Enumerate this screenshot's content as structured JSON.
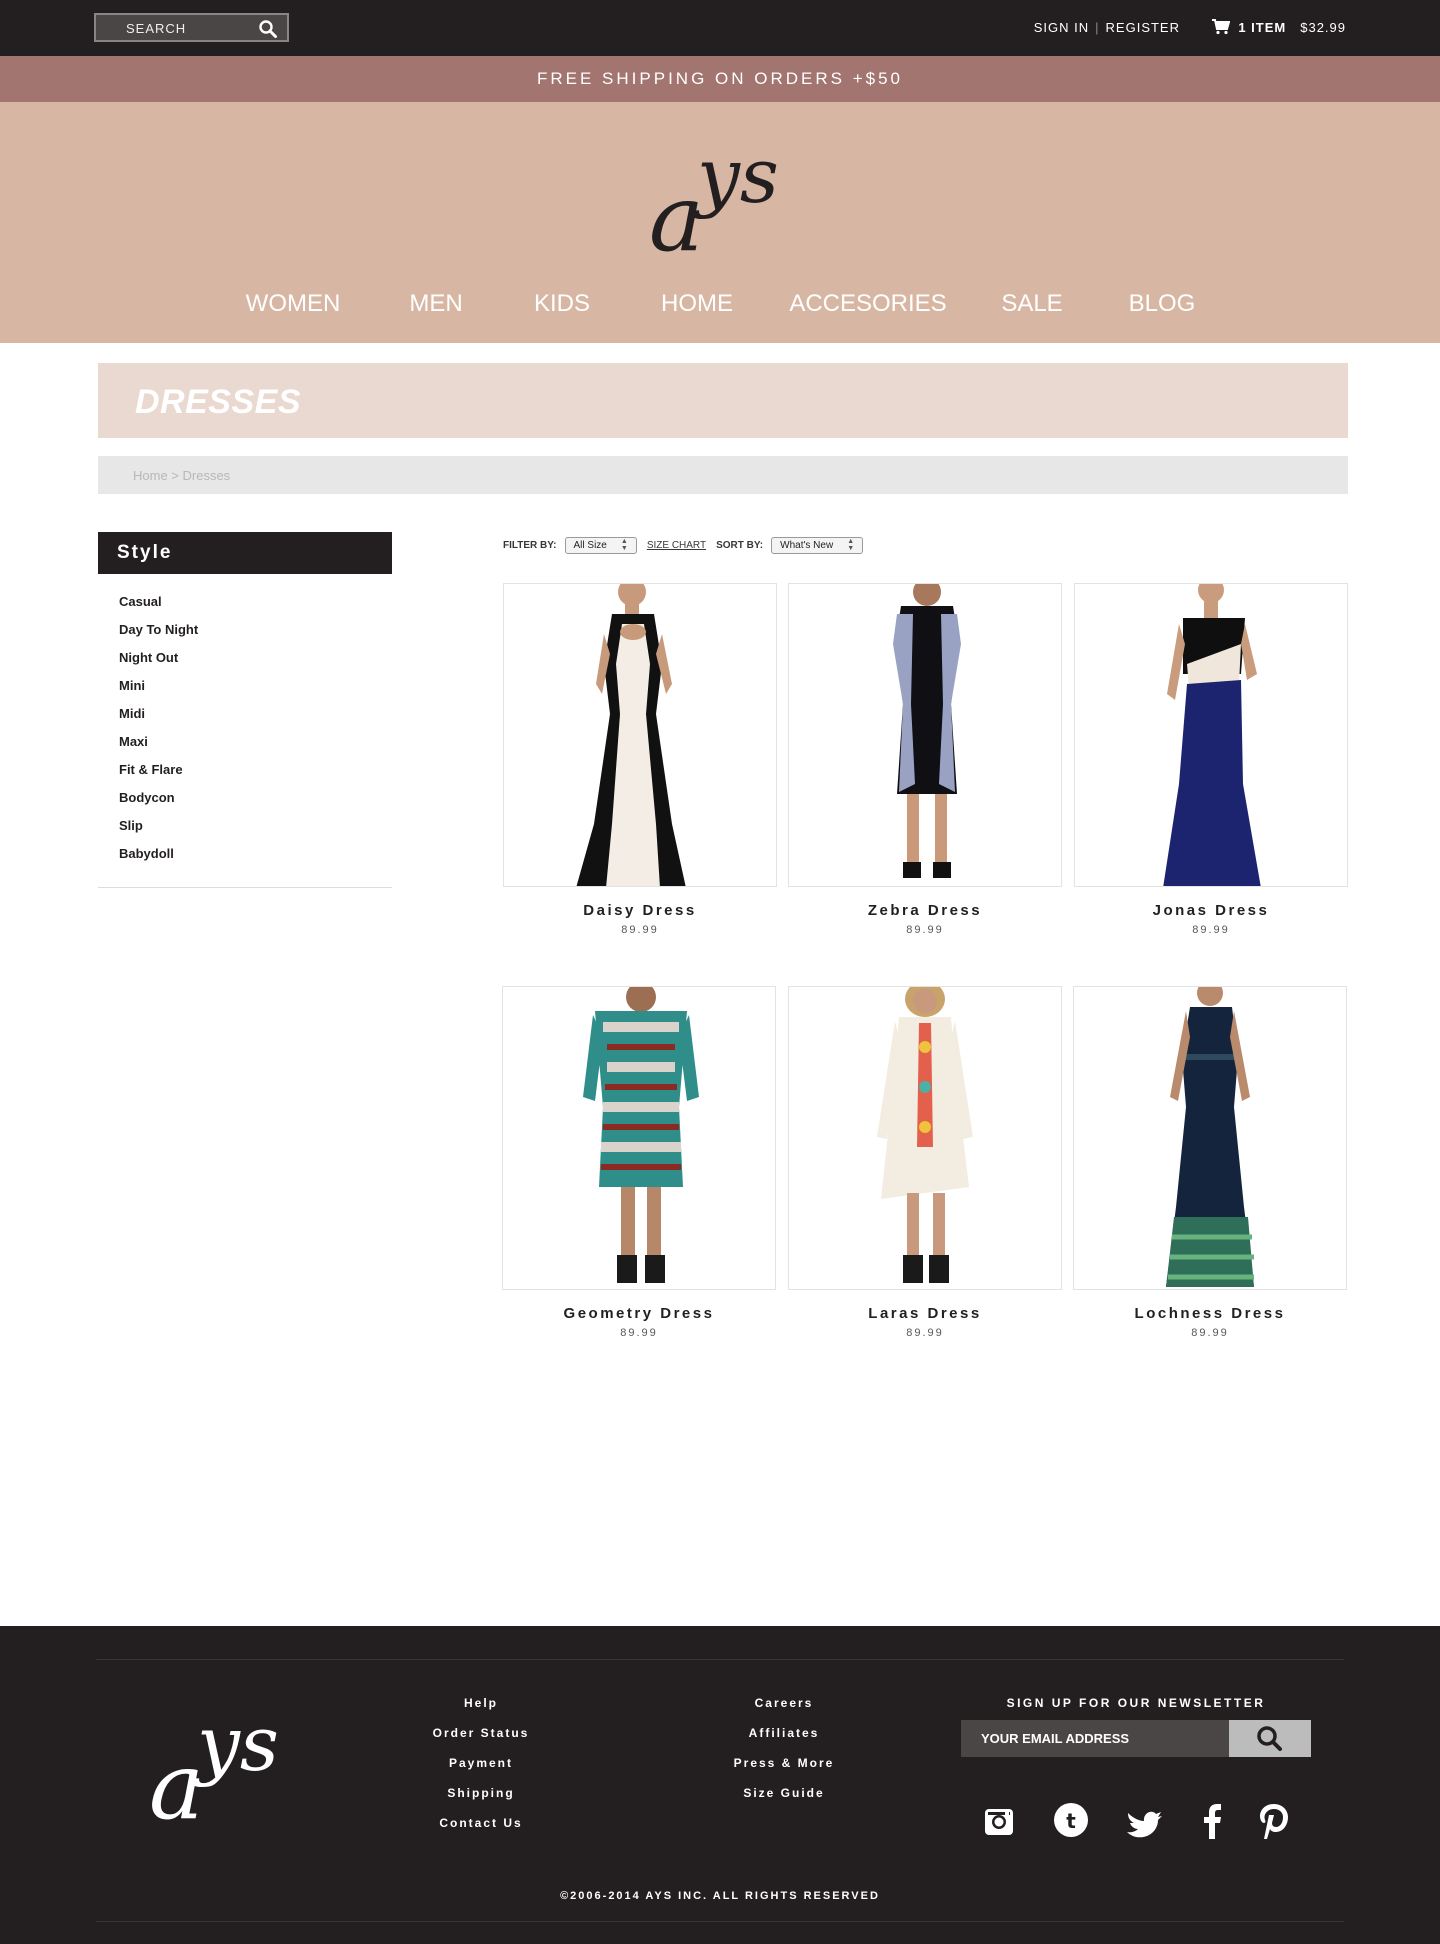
{
  "topbar": {
    "search_placeholder": "SEARCH",
    "sign_in": "SIGN IN",
    "separator": "|",
    "register": "REGISTER",
    "cart_count": "1 ITEM",
    "cart_total": "$32.99"
  },
  "promo": {
    "text": "FREE SHIPPING ON ORDERS +$50"
  },
  "brand": {
    "logo_text": "ays"
  },
  "nav": {
    "items": [
      "WOMEN",
      "MEN",
      "KIDS",
      "HOME",
      "ACCESORIES",
      "SALE",
      "BLOG"
    ]
  },
  "page": {
    "title": "DRESSES",
    "breadcrumb": "Home > Dresses"
  },
  "sidebar": {
    "heading": "Style",
    "items": [
      "Casual",
      "Day To Night",
      "Night Out",
      "Mini",
      "Midi",
      "Maxi",
      "Fit & Flare",
      "Bodycon",
      "Slip",
      "Babydoll"
    ]
  },
  "filters": {
    "filter_label": "FILTER BY:",
    "size_value": "All Size",
    "size_chart": "SIZE CHART",
    "sort_label": "SORT BY:",
    "sort_value": "What's New"
  },
  "products": [
    {
      "name": "Daisy Dress",
      "price": "89.99"
    },
    {
      "name": "Zebra Dress",
      "price": "89.99"
    },
    {
      "name": "Jonas Dress",
      "price": "89.99"
    },
    {
      "name": "Geometry Dress",
      "price": "89.99"
    },
    {
      "name": "Laras Dress",
      "price": "89.99"
    },
    {
      "name": "Lochness Dress",
      "price": "89.99"
    }
  ],
  "footer": {
    "col1": [
      "Help",
      "Order Status",
      "Payment",
      "Shipping",
      "Contact Us"
    ],
    "col2": [
      "Careers",
      "Affiliates",
      "Press & More",
      "Size Guide"
    ],
    "newsletter_label": "SIGN UP FOR OUR NEWSLETTER",
    "email_placeholder": "YOUR EMAIL ADDRESS",
    "social": [
      "instagram-icon",
      "tumblr-icon",
      "twitter-icon",
      "facebook-icon",
      "pinterest-icon"
    ],
    "copyright": "©2006-2014 AYS INC. ALL RIGHTS RESERVED"
  },
  "colors": {
    "dark": "#231f20",
    "promo": "#a27571",
    "header": "#d7b7a3",
    "title_band": "#e9d9d0"
  }
}
